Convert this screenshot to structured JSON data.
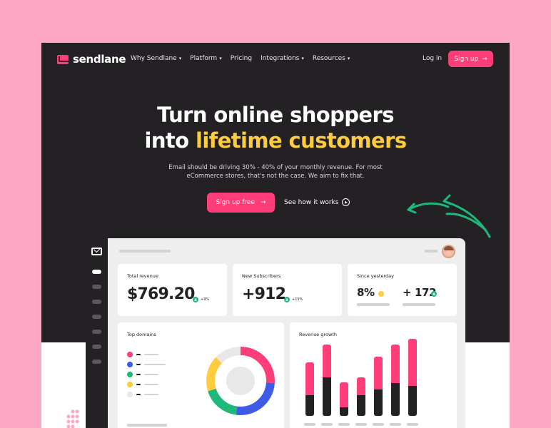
{
  "brand": {
    "name": "sendlane",
    "accent": "#FF3D79",
    "highlight": "#FFCC3E",
    "dark": "#232123",
    "page_bg": "#FFA8C6"
  },
  "nav": {
    "items": [
      {
        "label": "Why Sendlane",
        "dropdown": true
      },
      {
        "label": "Platform",
        "dropdown": true
      },
      {
        "label": "Pricing",
        "dropdown": false
      },
      {
        "label": "Integrations",
        "dropdown": true
      },
      {
        "label": "Resources",
        "dropdown": true
      }
    ],
    "login": "Log in",
    "signup": "Sign up"
  },
  "hero": {
    "line1": "Turn online shoppers",
    "line2_prefix": "into",
    "line2_accent": "lifetime customers",
    "subtitle": "Email should be driving 30% - 40% of your monthly revenue. For most eCommerce stores, that's not the case. We aim to fix that.",
    "cta": "Sign up free",
    "secondary": "See how it works"
  },
  "dashboard": {
    "total_revenue": {
      "title": "Total revenue",
      "value": "$769.20",
      "change": "+9%"
    },
    "new_subscribers": {
      "title": "New Subscribers",
      "value": "+912",
      "change": "+15%"
    },
    "since_yesterday": {
      "title": "Since yesterday",
      "pct": "8%",
      "count": "+ 172"
    },
    "top_domains": {
      "title": "Top domains",
      "segments": [
        {
          "color": "#FF3D79",
          "share": 0.26
        },
        {
          "color": "#3E5BE8",
          "share": 0.26
        },
        {
          "color": "#1DB87A",
          "share": 0.18
        },
        {
          "color": "#FFCC3E",
          "share": 0.17
        },
        {
          "color": "#E8E8E8",
          "share": 0.13
        }
      ]
    },
    "revenue_growth": {
      "title": "Revenue growth",
      "bars": [
        {
          "top": 0.55,
          "bottom": 0.35
        },
        {
          "top": 0.55,
          "bottom": 0.65
        },
        {
          "top": 0.42,
          "bottom": 0.15
        },
        {
          "top": 0.3,
          "bottom": 0.35
        },
        {
          "top": 0.55,
          "bottom": 0.45
        },
        {
          "top": 0.65,
          "bottom": 0.55
        },
        {
          "top": 0.8,
          "bottom": 0.5
        }
      ]
    }
  }
}
